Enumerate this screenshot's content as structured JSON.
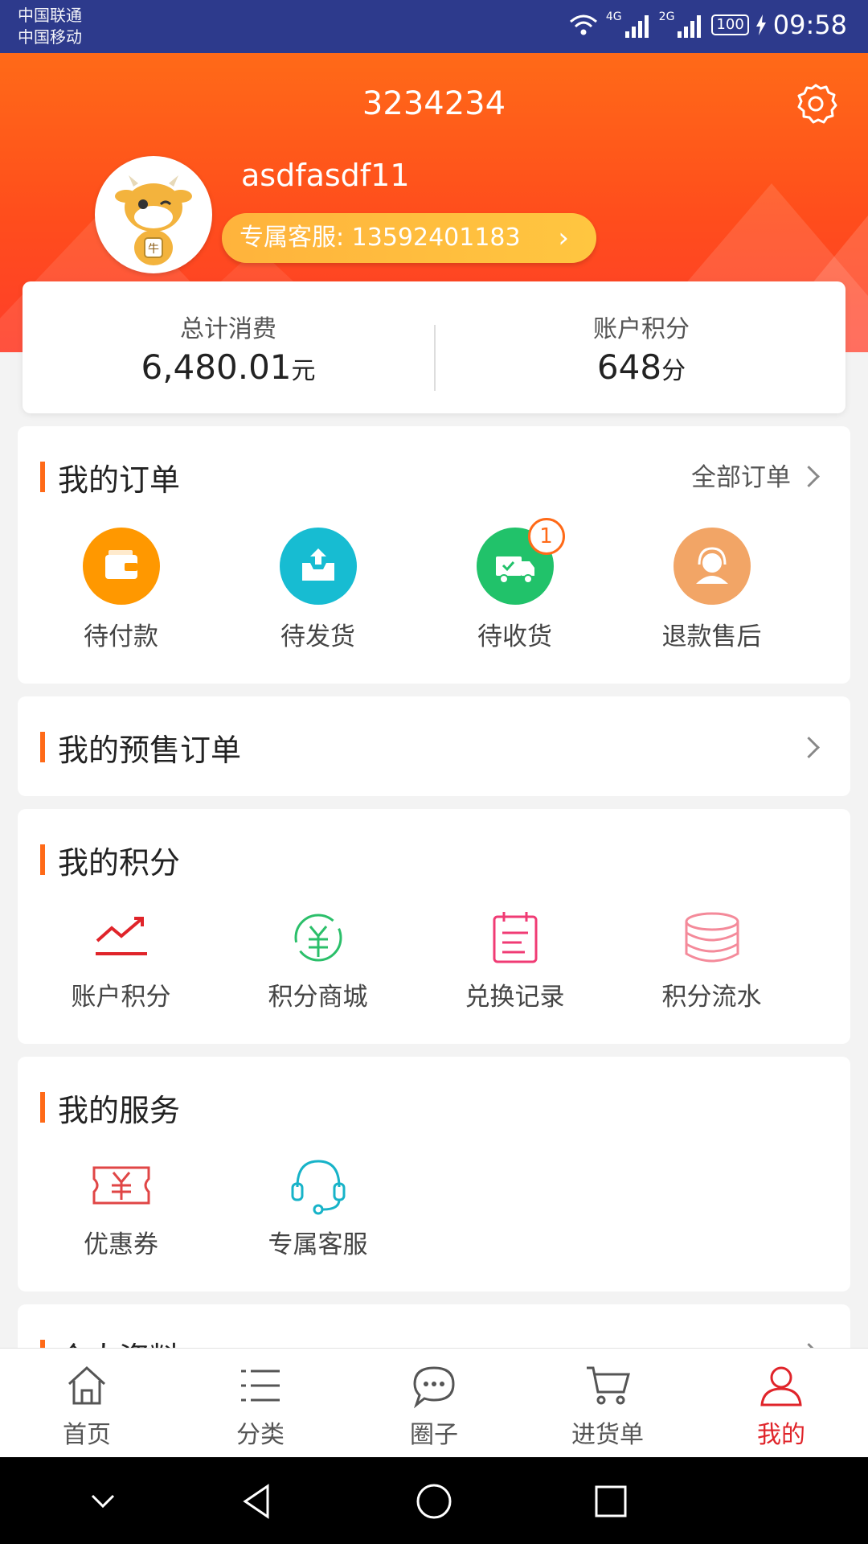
{
  "status_bar": {
    "carrier1": "中国联通",
    "carrier2": "中国移动",
    "net1": "4G",
    "net2": "2G",
    "battery": "100",
    "time": "09:58"
  },
  "header": {
    "shop_id": "3234234",
    "username": "asdfasdf11",
    "service_label": "专属客服: 13592401183"
  },
  "stats": {
    "total_label": "总计消费",
    "total_value": "6,480.01",
    "total_unit": "元",
    "points_label": "账户积分",
    "points_value": "648",
    "points_unit": "分"
  },
  "orders": {
    "title": "我的订单",
    "all_link": "全部订单",
    "items": [
      {
        "label": "待付款",
        "icon": "wallet-icon",
        "color": "#ff9800"
      },
      {
        "label": "待发货",
        "icon": "package-upload-icon",
        "color": "#17bcd2"
      },
      {
        "label": "待收货",
        "icon": "delivery-truck-icon",
        "color": "#21c26a",
        "badge": "1"
      },
      {
        "label": "退款售后",
        "icon": "customer-service-icon",
        "color": "#f2a566"
      }
    ]
  },
  "presale": {
    "title": "我的预售订单"
  },
  "points": {
    "title": "我的积分",
    "items": [
      {
        "label": "账户积分",
        "icon": "trend-chart-icon"
      },
      {
        "label": "积分商城",
        "icon": "yuan-exchange-icon"
      },
      {
        "label": "兑换记录",
        "icon": "clipboard-icon"
      },
      {
        "label": "积分流水",
        "icon": "coin-stack-icon"
      }
    ]
  },
  "services": {
    "title": "我的服务",
    "items": [
      {
        "label": "优惠券",
        "icon": "coupon-icon"
      },
      {
        "label": "专属客服",
        "icon": "headset-icon"
      }
    ]
  },
  "profile": {
    "title": "个人资料"
  },
  "bottom_nav": [
    {
      "label": "首页",
      "icon": "home-icon"
    },
    {
      "label": "分类",
      "icon": "list-icon"
    },
    {
      "label": "圈子",
      "icon": "chat-bubble-icon"
    },
    {
      "label": "进货单",
      "icon": "cart-icon"
    },
    {
      "label": "我的",
      "icon": "user-icon",
      "active": true
    }
  ],
  "colors": {
    "accent": "#ff6a18",
    "active_nav": "#e0242a",
    "status_bar": "#2d3a8c"
  }
}
